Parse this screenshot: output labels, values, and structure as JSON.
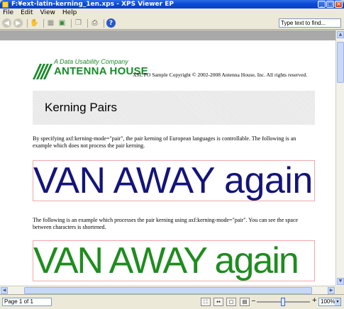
{
  "window": {
    "title": "F:¥ext-latin-kerning_1en.xps - XPS Viewer EP"
  },
  "menu": [
    "File",
    "Edit",
    "View",
    "Help"
  ],
  "toolbar": {
    "find_placeholder": "Type text to find..."
  },
  "document": {
    "logo_tagline": "A Data Usability Company",
    "logo_name": "ANTENNA HOUSE",
    "copyright": "XSL FO Sample Copyright © 2002-2008 Antenna House, Inc. All rights reserved.",
    "heading": "Kerning Pairs",
    "para1": "By specifying axf:kerning-mode=\"pair\", the pair kerning of European languages is controllable. The following is an example which does not process the pair kerning.",
    "sample1": "VAN AWAY again",
    "para2": "The following is an example which processes the pair kerning using axf:kerning-mode=\"pair\". You can see the space between characters is shortened.",
    "sample2": "VAN AWAY again"
  },
  "status": {
    "page": "Page 1 of 1",
    "zoom": "100%"
  },
  "colors": {
    "sample1": "#14147a",
    "sample2": "#1f8c1f",
    "logo": "#1a8a2a",
    "titlebar": "#0a4bd6"
  }
}
